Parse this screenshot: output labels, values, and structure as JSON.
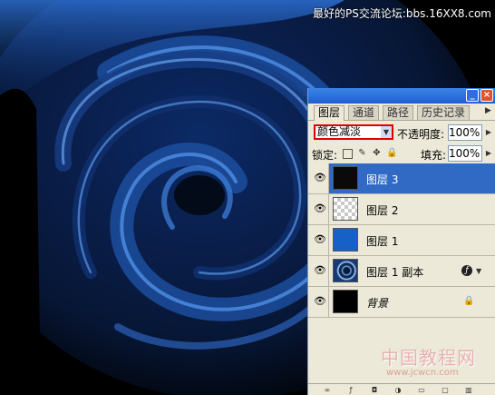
{
  "watermark_top": "最好的PS交流论坛:bbs.16XX8.com",
  "palette": {
    "tabs": [
      "图层",
      "通道",
      "路径",
      "历史记录"
    ],
    "blend_mode": "颜色减淡",
    "opacity_label": "不透明度:",
    "opacity_value": "100%",
    "lock_label": "锁定:",
    "fill_label": "填充:",
    "fill_value": "100%",
    "layers": [
      {
        "name": "图层 3",
        "visible": true,
        "selected": true
      },
      {
        "name": "图层 2",
        "visible": true,
        "selected": false
      },
      {
        "name": "图层 1",
        "visible": true,
        "selected": false
      },
      {
        "name": "图层 1 副本",
        "visible": true,
        "selected": false,
        "has_fx": true
      },
      {
        "name": "背景",
        "visible": true,
        "selected": false,
        "locked": true
      }
    ]
  },
  "icons": {
    "eye": "eye-icon",
    "lock": "lock-icon",
    "fx": "fx-icon",
    "minimize": "minimize-icon",
    "close": "close-icon"
  },
  "colors": {
    "selection": "#316ac5",
    "highlight_border": "#dd0000",
    "swirl_blue": "#3a7ad6"
  },
  "watermark_bottom": {
    "cn": "中国教程网",
    "url": "www.jcwcn.com"
  }
}
